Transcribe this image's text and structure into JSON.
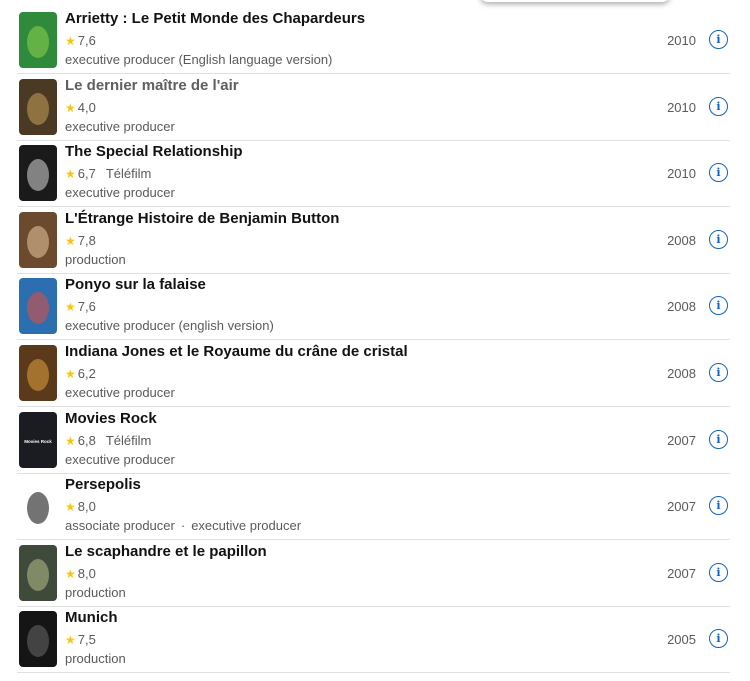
{
  "films": [
    {
      "title": "Arrietty : Le Petit Monde des Chapardeurs",
      "rating": "7,6",
      "kind": "",
      "roles": [
        "executive producer (English language version)"
      ],
      "year": "2010",
      "visited": false,
      "poster_color": "#2f8a3c",
      "poster_accent": "#8fd14f"
    },
    {
      "title": "Le dernier maître de l'air",
      "rating": "4,0",
      "kind": "",
      "roles": [
        "executive producer"
      ],
      "year": "2010",
      "visited": true,
      "poster_color": "#4a3a24",
      "poster_accent": "#c9a15a"
    },
    {
      "title": "The Special Relationship",
      "rating": "6,7",
      "kind": "Téléfilm",
      "roles": [
        "executive producer"
      ],
      "year": "2010",
      "visited": false,
      "poster_color": "#1a1a1a",
      "poster_accent": "#d9d9d9"
    },
    {
      "title": "L'Étrange Histoire de Benjamin Button",
      "rating": "7,8",
      "kind": "",
      "roles": [
        "production"
      ],
      "year": "2008",
      "visited": false,
      "poster_color": "#6b4a2e",
      "poster_accent": "#e8c9a0"
    },
    {
      "title": "Ponyo sur la falaise",
      "rating": "7,6",
      "kind": "",
      "roles": [
        "executive producer (english version)"
      ],
      "year": "2008",
      "visited": false,
      "poster_color": "#2c6fb0",
      "poster_accent": "#e84a3a"
    },
    {
      "title": "Indiana Jones et le Royaume du crâne de cristal",
      "rating": "6,2",
      "kind": "",
      "roles": [
        "executive producer"
      ],
      "year": "2008",
      "visited": false,
      "poster_color": "#5a3a1a",
      "poster_accent": "#e0a040"
    },
    {
      "title": "Movies Rock",
      "rating": "6,8",
      "kind": "Téléfilm",
      "roles": [
        "executive producer"
      ],
      "year": "2007",
      "visited": false,
      "poster_color": "#1b1b22",
      "poster_accent": "#ffffff",
      "poster_text": "Movies Rock"
    },
    {
      "title": "Persepolis",
      "rating": "8,0",
      "kind": "",
      "roles": [
        "associate producer",
        "executive producer"
      ],
      "year": "2007",
      "visited": false,
      "poster_color": "#ffffff",
      "poster_accent": "#000000"
    },
    {
      "title": "Le scaphandre et le papillon",
      "rating": "8,0",
      "kind": "",
      "roles": [
        "production"
      ],
      "year": "2007",
      "visited": false,
      "poster_color": "#3e4a3a",
      "poster_accent": "#b8c08a"
    },
    {
      "title": "Munich",
      "rating": "7,5",
      "kind": "",
      "roles": [
        "production"
      ],
      "year": "2005",
      "visited": false,
      "poster_color": "#151515",
      "poster_accent": "#6a6a6a"
    }
  ],
  "colors": {
    "star": "#f5c518",
    "info_icon": "#0e63be",
    "divider": "#e0e0e0"
  }
}
